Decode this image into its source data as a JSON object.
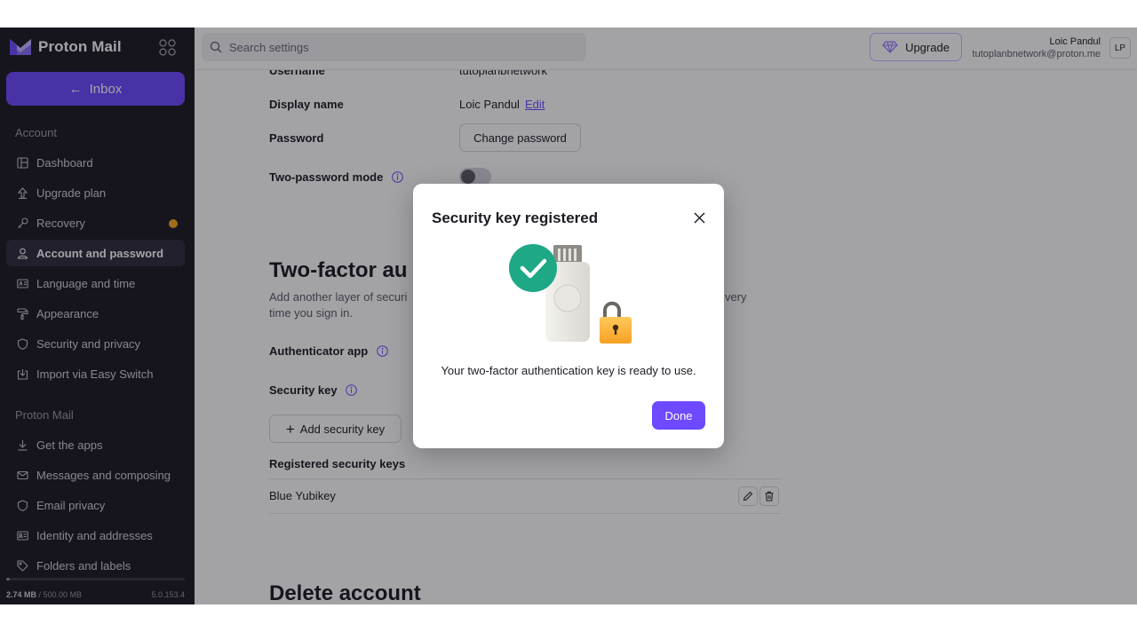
{
  "app": {
    "name": "Proton Mail"
  },
  "sidebar": {
    "inbox_label": "Inbox",
    "account_section": "Account",
    "account_items": [
      {
        "label": "Dashboard",
        "icon": "dashboard-icon"
      },
      {
        "label": "Upgrade plan",
        "icon": "upgrade-icon"
      },
      {
        "label": "Recovery",
        "icon": "key-icon",
        "badge": "warning-dot"
      },
      {
        "label": "Account and password",
        "icon": "user-icon",
        "active": true
      },
      {
        "label": "Language and time",
        "icon": "language-icon"
      },
      {
        "label": "Appearance",
        "icon": "paint-roller-icon"
      },
      {
        "label": "Security and privacy",
        "icon": "shield-icon"
      },
      {
        "label": "Import via Easy Switch",
        "icon": "import-icon"
      }
    ],
    "mail_section": "Proton Mail",
    "mail_items": [
      {
        "label": "Get the apps",
        "icon": "download-icon"
      },
      {
        "label": "Messages and composing",
        "icon": "envelope-icon"
      },
      {
        "label": "Email privacy",
        "icon": "shield-icon"
      },
      {
        "label": "Identity and addresses",
        "icon": "id-card-icon"
      },
      {
        "label": "Folders and labels",
        "icon": "tag-icon"
      }
    ],
    "storage_used": "2.74 MB",
    "storage_total": "/ 500.00 MB",
    "storage_fraction": 0.0055,
    "version": "5.0.153.4"
  },
  "topbar": {
    "search_placeholder": "Search settings",
    "upgrade_label": "Upgrade",
    "user_name": "Loic Pandul",
    "user_email": "tutoplanbnetwork@proton.me",
    "avatar_initials": "LP"
  },
  "main": {
    "username_label": "Username",
    "username_value": "tutoplanbnetwork",
    "display_name_label": "Display name",
    "display_name_value": "Loic Pandul",
    "edit_link": "Edit",
    "password_label": "Password",
    "change_password_button": "Change password",
    "two_password_label": "Two-password mode",
    "two_password_enabled": false,
    "twofa_heading": "Two-factor au",
    "twofa_desc_line1": "Add another layer of securi",
    "twofa_desc_line1_end": "very",
    "twofa_desc_line2": "time you sign in.",
    "authenticator_label": "Authenticator app",
    "security_key_label": "Security key",
    "add_security_key_button": "Add security key",
    "registered_keys_label": "Registered security keys",
    "registered_keys": [
      {
        "name": "Blue Yubikey"
      }
    ],
    "delete_heading": "Delete account"
  },
  "modal": {
    "title": "Security key registered",
    "message": "Your two-factor authentication key is ready to use.",
    "done_label": "Done"
  },
  "colors": {
    "accent": "#6d4aff",
    "sidebar_bg": "#1c1b24",
    "success": "#1ea885",
    "warning": "#f5a623"
  }
}
